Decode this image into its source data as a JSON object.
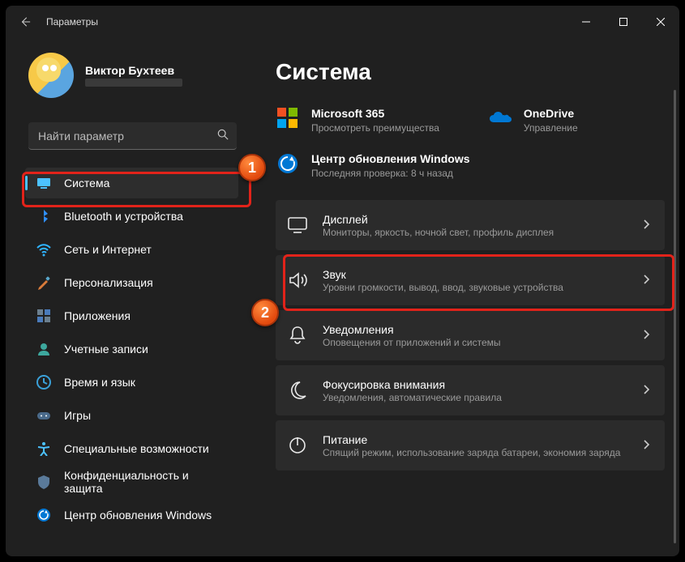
{
  "window": {
    "title": "Параметры"
  },
  "profile": {
    "name": "Виктор Бухтеев"
  },
  "search": {
    "placeholder": "Найти параметр"
  },
  "nav": [
    {
      "label": "Система",
      "icon": "system",
      "active": true
    },
    {
      "label": "Bluetooth и устройства",
      "icon": "bluetooth"
    },
    {
      "label": "Сеть и Интернет",
      "icon": "wifi"
    },
    {
      "label": "Персонализация",
      "icon": "brush"
    },
    {
      "label": "Приложения",
      "icon": "apps"
    },
    {
      "label": "Учетные записи",
      "icon": "account"
    },
    {
      "label": "Время и язык",
      "icon": "time"
    },
    {
      "label": "Игры",
      "icon": "games"
    },
    {
      "label": "Специальные возможности",
      "icon": "accessibility"
    },
    {
      "label": "Конфиденциальность и защита",
      "icon": "privacy"
    },
    {
      "label": "Центр обновления Windows",
      "icon": "update"
    }
  ],
  "main": {
    "heading": "Система",
    "cards": [
      {
        "title": "Microsoft 365",
        "sub": "Просмотреть преимущества",
        "icon": "ms365"
      },
      {
        "title": "OneDrive",
        "sub": "Управление",
        "icon": "onedrive"
      }
    ],
    "update_card": {
      "title": "Центр обновления Windows",
      "sub": "Последняя проверка: 8 ч назад",
      "icon": "update"
    },
    "items": [
      {
        "title": "Дисплей",
        "sub": "Мониторы, яркость, ночной свет, профиль дисплея",
        "icon": "display"
      },
      {
        "title": "Звук",
        "sub": "Уровни громкости, вывод, ввод, звуковые устройства",
        "icon": "sound"
      },
      {
        "title": "Уведомления",
        "sub": "Оповещения от приложений и системы",
        "icon": "bell"
      },
      {
        "title": "Фокусировка внимания",
        "sub": "Уведомления, автоматические правила",
        "icon": "moon"
      },
      {
        "title": "Питание",
        "sub": "Спящий режим, использование заряда батареи, экономия заряда",
        "icon": "power"
      }
    ]
  },
  "annotations": {
    "badge1": "1",
    "badge2": "2"
  }
}
